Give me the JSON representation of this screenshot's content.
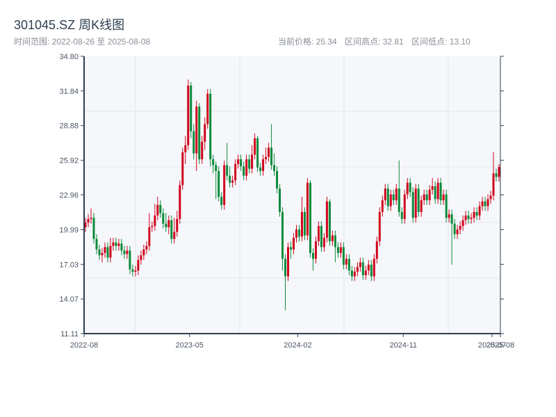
{
  "header": {
    "title": "301045.SZ 周K线图",
    "range_label": "时间范围: 2022-08-26 至 2025-08-08",
    "current_price": "当前价格: 25.34",
    "range_high": "区间高点: 32.81",
    "range_low": "区间低点: 13.10"
  },
  "colors": {
    "up": "#d0021b",
    "down": "#0b8a3a",
    "axis": "#2d3e50",
    "plot_bg": "#f5f7fa",
    "grid": "#e1e4ea"
  },
  "chart_data": {
    "type": "candlestick",
    "title": "301045.SZ 周K线图",
    "ylim": [
      11.11,
      34.8
    ],
    "yticks": [
      "34.80",
      "31.84",
      "28.88",
      "25.92",
      "22.96",
      "19.99",
      "17.03",
      "14.07",
      "11.11"
    ],
    "xticks": [
      {
        "label": "2022-08",
        "index": 0
      },
      {
        "label": "2023-05",
        "index": 38
      },
      {
        "label": "2024-02",
        "index": 77
      },
      {
        "label": "2024-11",
        "index": 115
      },
      {
        "label": "2025-07",
        "index": 147
      },
      {
        "label": "2025-08",
        "index": 150
      }
    ],
    "open": [
      20.2,
      20.6,
      20.9,
      21.0,
      19.2,
      18.3,
      17.8,
      18.0,
      18.5,
      17.6,
      18.6,
      18.9,
      18.6,
      18.8,
      18.2,
      17.9,
      18.2,
      16.6,
      16.4,
      16.5,
      17.4,
      17.8,
      18.3,
      18.6,
      20.2,
      20.3,
      21.2,
      22.1,
      21.4,
      20.5,
      20.2,
      20.8,
      19.2,
      19.8,
      20.9,
      23.8,
      26.6,
      27.2,
      32.3,
      28.4,
      26.5,
      30.5,
      26.0,
      27.5,
      29.0,
      31.6,
      26.0,
      25.5,
      25.0,
      22.8,
      22.1,
      25.5,
      24.6,
      24.0,
      24.2,
      25.6,
      26.0,
      25.4,
      24.6,
      26.0,
      25.2,
      26.4,
      27.8,
      25.3,
      25.0,
      26.0,
      26.2,
      27.0,
      25.5,
      25.0,
      23.5,
      21.5,
      17.5,
      16.0,
      18.5,
      18.3,
      19.3,
      20.0,
      19.4,
      21.5,
      19.5,
      24.0,
      18.0,
      17.5,
      19.0,
      20.3,
      18.5,
      19.3,
      22.4,
      19.0,
      19.5,
      18.5,
      18.0,
      18.5,
      17.0,
      17.5,
      16.5,
      16.0,
      16.4,
      16.8,
      17.2,
      16.1,
      16.5,
      17.0,
      16.0,
      17.5,
      19.0,
      21.5,
      22.5,
      23.5,
      22.0,
      23.0,
      22.5,
      23.5,
      21.5,
      20.9,
      23.0,
      24.0,
      23.2,
      21.0,
      23.5,
      21.5,
      22.5,
      23.0,
      22.5,
      23.4,
      23.7,
      22.6,
      24.0,
      22.5,
      23.0,
      21.0,
      21.3,
      20.5,
      19.6,
      20.0,
      20.3,
      20.8,
      21.2,
      20.9,
      21.0,
      21.5,
      21.2,
      22.0,
      22.4,
      22.0,
      22.6,
      22.9,
      24.8,
      24.5
    ],
    "close": [
      20.6,
      20.9,
      21.0,
      19.2,
      18.3,
      17.8,
      18.0,
      18.5,
      17.6,
      18.6,
      18.9,
      18.6,
      18.8,
      18.2,
      17.9,
      18.2,
      16.6,
      16.4,
      16.5,
      17.4,
      17.8,
      18.3,
      18.6,
      20.2,
      20.3,
      21.2,
      22.1,
      21.4,
      20.5,
      20.2,
      20.8,
      19.2,
      19.8,
      20.9,
      23.8,
      26.6,
      27.2,
      32.3,
      28.4,
      26.5,
      30.5,
      26.0,
      27.5,
      29.0,
      31.6,
      26.0,
      25.5,
      25.0,
      22.8,
      22.1,
      25.5,
      24.6,
      24.0,
      24.2,
      25.6,
      26.0,
      25.4,
      24.6,
      26.0,
      25.2,
      26.4,
      27.8,
      25.3,
      25.0,
      26.0,
      26.2,
      27.0,
      25.5,
      25.0,
      23.5,
      21.5,
      17.5,
      16.0,
      18.5,
      18.3,
      19.3,
      20.0,
      19.4,
      21.5,
      19.5,
      24.0,
      18.0,
      17.5,
      19.0,
      20.3,
      18.5,
      19.3,
      22.4,
      19.0,
      19.5,
      18.5,
      18.0,
      18.5,
      17.0,
      17.5,
      16.5,
      16.0,
      16.4,
      16.8,
      17.2,
      16.1,
      16.5,
      17.0,
      16.0,
      17.5,
      19.0,
      21.5,
      22.5,
      23.5,
      22.0,
      23.0,
      22.5,
      23.5,
      21.5,
      20.9,
      23.0,
      24.0,
      23.2,
      21.0,
      23.5,
      21.5,
      22.5,
      23.0,
      22.5,
      23.4,
      23.7,
      22.6,
      24.0,
      22.5,
      23.0,
      21.0,
      21.3,
      20.5,
      19.6,
      20.0,
      20.3,
      20.8,
      21.2,
      20.9,
      21.0,
      21.5,
      21.2,
      22.0,
      22.4,
      22.0,
      22.6,
      22.9,
      24.8,
      24.5,
      25.34
    ],
    "high": [
      21.0,
      21.3,
      21.8,
      21.4,
      19.6,
      18.7,
      18.4,
      18.9,
      18.9,
      19.3,
      19.3,
      19.3,
      19.2,
      19.2,
      18.6,
      18.6,
      18.6,
      17.0,
      16.9,
      17.8,
      18.2,
      18.7,
      19.0,
      21.4,
      20.7,
      22.2,
      22.8,
      22.5,
      21.8,
      21.4,
      21.2,
      21.2,
      21.0,
      21.6,
      24.2,
      27.0,
      28.0,
      32.81,
      32.6,
      29.0,
      31.0,
      30.8,
      28.0,
      29.6,
      32.0,
      32.0,
      26.4,
      25.8,
      25.4,
      23.2,
      25.9,
      27.4,
      25.4,
      24.6,
      26.0,
      26.4,
      26.4,
      25.8,
      26.4,
      26.4,
      27.2,
      28.2,
      28.0,
      25.7,
      26.4,
      27.0,
      27.4,
      29.0,
      26.5,
      25.4,
      23.9,
      21.9,
      17.9,
      18.9,
      19.0,
      19.7,
      20.4,
      20.4,
      22.8,
      21.9,
      24.4,
      24.2,
      18.4,
      19.4,
      20.7,
      20.7,
      19.7,
      22.8,
      22.6,
      19.9,
      19.9,
      18.9,
      18.9,
      18.9,
      17.9,
      17.9,
      16.9,
      16.8,
      17.2,
      17.6,
      17.6,
      16.9,
      17.4,
      17.4,
      17.9,
      19.4,
      21.9,
      22.9,
      23.9,
      23.9,
      23.4,
      23.4,
      23.9,
      25.9,
      21.9,
      23.4,
      24.4,
      24.4,
      23.6,
      23.9,
      23.9,
      22.9,
      23.4,
      23.4,
      23.8,
      24.4,
      24.1,
      24.4,
      24.4,
      23.4,
      23.4,
      21.7,
      21.7,
      20.9,
      20.4,
      20.7,
      21.2,
      21.6,
      21.6,
      21.4,
      21.9,
      21.9,
      22.4,
      22.8,
      22.8,
      23.0,
      23.3,
      26.6,
      25.2,
      25.6
    ],
    "low": [
      19.8,
      20.2,
      20.5,
      18.8,
      17.9,
      17.4,
      17.2,
      17.6,
      17.2,
      17.2,
      18.2,
      18.2,
      18.2,
      17.8,
      17.5,
      17.5,
      16.2,
      16.0,
      16.0,
      16.1,
      17.0,
      17.4,
      17.9,
      18.2,
      19.8,
      19.9,
      20.8,
      21.0,
      20.1,
      19.8,
      19.6,
      18.8,
      18.8,
      19.4,
      20.5,
      23.4,
      25.6,
      26.8,
      27.8,
      26.0,
      25.0,
      25.6,
      25.6,
      26.8,
      28.6,
      25.4,
      24.8,
      22.6,
      22.4,
      21.7,
      21.7,
      24.2,
      23.6,
      23.6,
      23.8,
      25.2,
      25.0,
      24.2,
      24.2,
      24.8,
      24.8,
      26.0,
      24.9,
      24.6,
      24.6,
      25.6,
      25.8,
      25.1,
      24.6,
      23.1,
      21.1,
      16.5,
      13.1,
      15.6,
      17.5,
      17.9,
      18.9,
      19.0,
      19.0,
      19.1,
      19.1,
      17.6,
      16.5,
      17.1,
      18.6,
      18.1,
      18.1,
      18.9,
      18.6,
      18.6,
      17.2,
      17.6,
      17.6,
      16.6,
      16.6,
      16.1,
      15.6,
      15.6,
      16.0,
      16.4,
      15.7,
      15.7,
      16.1,
      15.6,
      15.6,
      17.1,
      18.6,
      21.1,
      22.1,
      21.6,
      21.6,
      22.1,
      22.1,
      21.1,
      20.5,
      20.5,
      22.6,
      22.8,
      20.6,
      20.6,
      21.1,
      21.1,
      22.1,
      22.1,
      22.1,
      23.0,
      22.2,
      22.2,
      22.1,
      22.1,
      20.6,
      20.6,
      17.0,
      19.2,
      19.2,
      19.6,
      19.9,
      20.4,
      20.5,
      20.5,
      20.6,
      20.8,
      20.8,
      21.6,
      21.6,
      21.6,
      22.2,
      22.5,
      24.1,
      24.1
    ]
  }
}
